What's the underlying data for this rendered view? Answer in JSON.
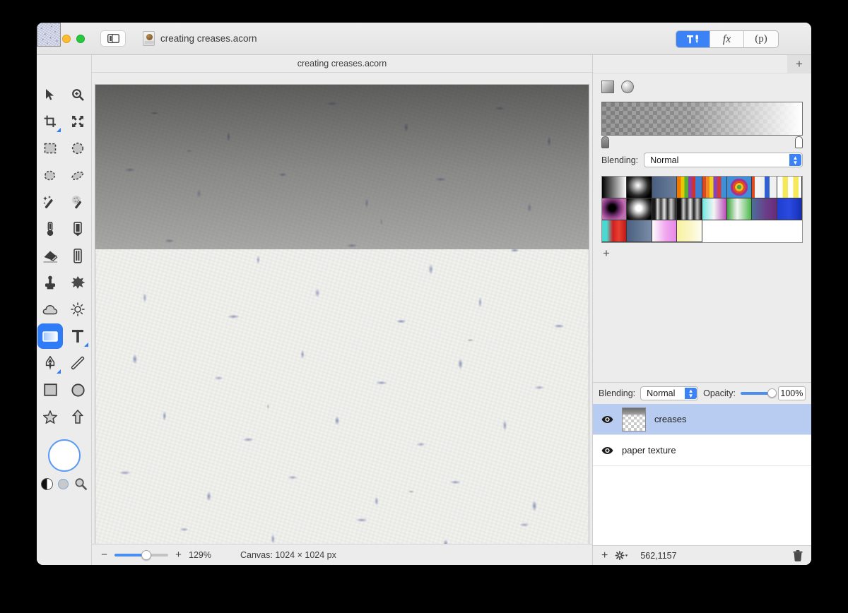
{
  "window": {
    "title": "creating creases.acorn",
    "document_icon": "acorn-document-icon",
    "sidebar_toggle": "sidebar-toggle-icon"
  },
  "toolbar": {
    "segments": [
      {
        "id": "tools-palette",
        "label": "",
        "icon": "hammer-tools-icon",
        "active": true
      },
      {
        "id": "filters",
        "label": "fx",
        "icon": "fx-icon",
        "active": false
      },
      {
        "id": "presets",
        "label": "(p)",
        "icon": "p-icon",
        "active": false
      }
    ]
  },
  "tools": {
    "items": [
      {
        "name": "move-tool",
        "icon": "arrow-cursor-icon",
        "selected": false,
        "submenu": false
      },
      {
        "name": "zoom-tool",
        "icon": "magnifier-plus-icon",
        "selected": false,
        "submenu": false
      },
      {
        "name": "crop-tool",
        "icon": "crop-icon",
        "selected": false,
        "submenu": true
      },
      {
        "name": "transform-tool",
        "icon": "move-arrows-icon",
        "selected": false,
        "submenu": false
      },
      {
        "name": "rectangular-select-tool",
        "icon": "dashed-rectangle-icon",
        "selected": false,
        "submenu": false
      },
      {
        "name": "elliptical-select-tool",
        "icon": "dashed-ellipse-icon",
        "selected": false,
        "submenu": false
      },
      {
        "name": "lasso-tool",
        "icon": "lasso-icon",
        "selected": false,
        "submenu": false
      },
      {
        "name": "polygon-lasso-tool",
        "icon": "polygon-lasso-icon",
        "selected": false,
        "submenu": false
      },
      {
        "name": "magic-wand-tool",
        "icon": "magic-wand-icon",
        "selected": false,
        "submenu": false
      },
      {
        "name": "instant-alpha-tool",
        "icon": "instant-alpha-wand-icon",
        "selected": false,
        "submenu": false
      },
      {
        "name": "paint-bucket-tool",
        "icon": "paint-bucket-icon",
        "selected": false,
        "submenu": false
      },
      {
        "name": "pencil-tool",
        "icon": "pencil-icon",
        "selected": false,
        "submenu": false
      },
      {
        "name": "eraser-tool",
        "icon": "eraser-icon",
        "selected": false,
        "submenu": false
      },
      {
        "name": "marker-tool",
        "icon": "marker-icon",
        "selected": false,
        "submenu": false
      },
      {
        "name": "clone-stamp-tool",
        "icon": "clone-stamp-icon",
        "selected": false,
        "submenu": false
      },
      {
        "name": "smudge-tool",
        "icon": "smudge-splatter-icon",
        "selected": false,
        "submenu": false
      },
      {
        "name": "blur-tool",
        "icon": "cloud-icon",
        "selected": false,
        "submenu": false
      },
      {
        "name": "dodge-tool",
        "icon": "sun-icon",
        "selected": false,
        "submenu": false
      },
      {
        "name": "gradient-tool",
        "icon": "gradient-rectangle-icon",
        "selected": true,
        "submenu": false
      },
      {
        "name": "text-tool",
        "icon": "text-t-icon",
        "selected": false,
        "submenu": true
      },
      {
        "name": "pen-tool",
        "icon": "pen-nib-icon",
        "selected": false,
        "submenu": true
      },
      {
        "name": "line-tool",
        "icon": "line-icon",
        "selected": false,
        "submenu": false
      },
      {
        "name": "rectangle-tool",
        "icon": "rectangle-icon",
        "selected": false,
        "submenu": false
      },
      {
        "name": "ellipse-tool",
        "icon": "ellipse-icon",
        "selected": false,
        "submenu": false
      },
      {
        "name": "star-tool",
        "icon": "star-icon",
        "selected": false,
        "submenu": false
      },
      {
        "name": "arrow-shape-tool",
        "icon": "up-arrow-icon",
        "selected": false,
        "submenu": false
      }
    ],
    "color_well": {
      "name": "foreground-color-well",
      "color": "#ffffff",
      "border_color": "#5a9bf6",
      "swap_icon": "black-white-swap-icon",
      "secondary_icon": "background-color-dot-icon",
      "picker_icon": "eyedropper-magnifier-icon"
    }
  },
  "document": {
    "tab_title": "creating creases.acorn",
    "canvas_size_label": "Canvas: 1024 × 1024 px",
    "zoom_level": "129%",
    "zoom_minus": "−",
    "zoom_plus": "+"
  },
  "inspector": {
    "add_button": "+",
    "gradient": {
      "type_linear": "linear-gradient-type",
      "type_radial": "radial-gradient-type",
      "preview_label": "gradient-preview",
      "stop_left": "gradient-stop-left",
      "stop_right": "gradient-stop-right",
      "blending_label": "Blending:",
      "blending_value": "Normal",
      "presets_add": "+",
      "presets": [
        {
          "name": "black-to-white",
          "css": "linear-gradient(90deg,#000,#fff)"
        },
        {
          "name": "white-radial-on-black",
          "css": "radial-gradient(circle at 45% 42%,#fff 0%,#cfcfcf 14%,#2a2a2a 55%,#000 80%)"
        },
        {
          "name": "slate-blue-flat",
          "css": "linear-gradient(90deg,#4a5f80,#6a7e9c)"
        },
        {
          "name": "rainbow-stripes-a",
          "css": "linear-gradient(90deg,#f07800 0 16%,#e8c800 16% 30%,#58b030 30% 46%,#8a3fb0 46% 60%,#d03030 60% 74%,#3f7fd0 74% 100%)"
        },
        {
          "name": "rainbow-stripes-b",
          "css": "linear-gradient(90deg,#d84a28 0 14%,#f08a20 14% 30%,#f0d020 30% 46%,#8844b8 46% 62%,#d03a3a 62% 78%,#3f8fd8 78% 100%)"
        },
        {
          "name": "target-radial",
          "css": "radial-gradient(circle at 50% 50%,#4aa84a 0 14%,#f0c020 14% 26%,#e04a20 26% 40%,#a83090 40% 54%,#3f8fd8 54% 100%)"
        },
        {
          "name": "red-white-blue-stripes",
          "css": "linear-gradient(90deg,#e04a20 0 12%,#f5f5f5 12% 34%,#f0f0f0 34% 52%,#2f5fd0 52% 72%,#f0f0f0 72% 100%)"
        },
        {
          "name": "yellow-checker-fade",
          "css": "linear-gradient(90deg,#fdfdfd 0 22%,#f5e85a 22% 44%,#fdfdfd 44% 66%,#f5e85a 66% 88%,#fdfdfd 88% 100%)"
        },
        {
          "name": "magenta-radial-black-center",
          "css": "radial-gradient(circle at 42% 45%,#000 0 18%,#6a2a6a 40%,#c06ab0 70%,#b87ab0 100%)"
        },
        {
          "name": "white-blob-radial",
          "css": "radial-gradient(circle at 48% 46%,#fff 0 16%,#bdbdbd 32%,#3a3a3a 62%,#000 85%)"
        },
        {
          "name": "grayscale-bands-a",
          "css": "linear-gradient(90deg,#1a1a1a 0 12%,#d8d8d8 22%,#3a3a3a 36%,#e8e8e8 50%,#2a2a2a 64%,#d0d0d0 78%,#1a1a1a 100%)"
        },
        {
          "name": "grayscale-bands-b",
          "css": "linear-gradient(90deg,#0d0d0d 0 14%,#cfcfcf 26%,#2f2f2f 40%,#ededed 54%,#242424 68%,#c8c8c8 82%,#0d0d0d 100%)"
        },
        {
          "name": "cyan-white-magenta",
          "css": "linear-gradient(90deg,#6fe8e0 0%,#f4f4f4 48%,#b84ab8 100%)"
        },
        {
          "name": "green-white-green",
          "css": "linear-gradient(90deg,#3aa83a 0%,#f4f4f4 42%,#4ab84a 100%)"
        },
        {
          "name": "steel-to-purple",
          "css": "linear-gradient(90deg,#4a6f9a 0%,#6a3f8a 55%,#6a2a7a 100%)"
        },
        {
          "name": "blue-to-deep-blue",
          "css": "linear-gradient(90deg,#1f3fd0 0%,#2a4ae0 50%,#1530b8 100%)"
        },
        {
          "name": "teal-red",
          "css": "linear-gradient(90deg,#4ad8d0 0 20%,#d02020 45%,#e84030 70%,#c01818 100%)"
        },
        {
          "name": "slate-gray-blue",
          "css": "linear-gradient(90deg,#4a5f80,#7a8ea8)"
        },
        {
          "name": "white-to-pink",
          "css": "linear-gradient(90deg,#fdfdfd 0%,#f0a8ee 55%,#e888e8 100%)"
        },
        {
          "name": "yellow-to-white",
          "css": "linear-gradient(90deg,#f8f2a0 0%,#faf6c8 55%,#fdfdf0 100%)"
        }
      ]
    },
    "layers_panel": {
      "blending_label": "Blending:",
      "blending_value": "Normal",
      "opacity_label": "Opacity:",
      "opacity_value": "100%",
      "layers": [
        {
          "name": "creases",
          "visible": true,
          "selected": true,
          "thumb": "gradient-transparent-thumb"
        },
        {
          "name": "paper texture",
          "visible": true,
          "selected": false,
          "thumb": "paper-texture-thumb"
        }
      ],
      "footer": {
        "add_label": "+",
        "gear_icon": "gear-dropdown-icon",
        "coordinates": "562,1157",
        "trash_icon": "trash-icon"
      }
    }
  }
}
